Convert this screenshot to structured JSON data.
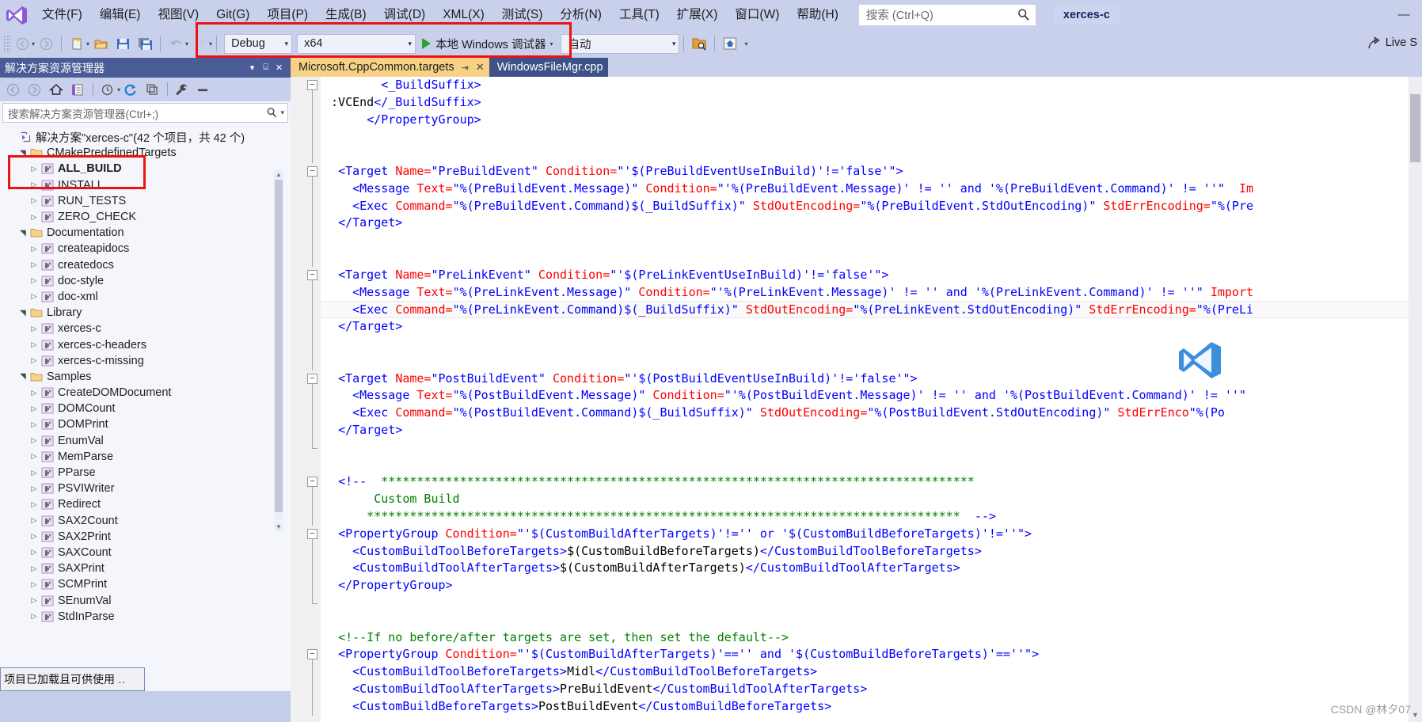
{
  "window": {
    "project_chip": "xerces-c",
    "minimize_label": "—",
    "search": {
      "placeholder": "搜索 (Ctrl+Q)",
      "icon": "magnifier-icon"
    }
  },
  "menu": {
    "items": [
      {
        "label": "文件(F)"
      },
      {
        "label": "编辑(E)"
      },
      {
        "label": "视图(V)"
      },
      {
        "label": "Git(G)"
      },
      {
        "label": "项目(P)"
      },
      {
        "label": "生成(B)"
      },
      {
        "label": "调试(D)"
      },
      {
        "label": "XML(X)"
      },
      {
        "label": "测试(S)"
      },
      {
        "label": "分析(N)"
      },
      {
        "label": "工具(T)"
      },
      {
        "label": "扩展(X)"
      },
      {
        "label": "窗口(W)"
      },
      {
        "label": "帮助(H)"
      }
    ]
  },
  "toolbar": {
    "configuration": "Debug",
    "platform": "x64",
    "start_label": "本地 Windows 调试器",
    "auto_label": "自动",
    "live_share_label": "Live S",
    "icons": [
      "back-arrow-icon",
      "forward-arrow-icon",
      "new-item-icon",
      "open-file-icon",
      "save-icon",
      "save-all-icon",
      "undo-icon",
      "redo-icon",
      "preview-changes-icon",
      "home-icon"
    ]
  },
  "solution_explorer": {
    "title": "解决方案资源管理器",
    "search_placeholder": "搜索解决方案资源管理器(Ctrl+;)",
    "toolbar_icons": [
      "back-icon",
      "forward-icon",
      "home-icon",
      "show-all-files-icon",
      "pending-changes-icon",
      "refresh-icon",
      "collapse-all-icon",
      "properties-icon",
      "preview-icon"
    ],
    "root": "解决方案\"xerces-c\"(42 个项目，共 42 个)",
    "tree": [
      {
        "label": "CMakePredefinedTargets",
        "kind": "folder",
        "depth": 1,
        "state": "expanded",
        "bold": false
      },
      {
        "label": "ALL_BUILD",
        "kind": "project",
        "depth": 2,
        "state": "collapsed",
        "bold": true
      },
      {
        "label": "INSTALL",
        "kind": "project",
        "depth": 2,
        "state": "collapsed",
        "bold": false
      },
      {
        "label": "RUN_TESTS",
        "kind": "project",
        "depth": 2,
        "state": "collapsed",
        "bold": false
      },
      {
        "label": "ZERO_CHECK",
        "kind": "project",
        "depth": 2,
        "state": "collapsed",
        "bold": false
      },
      {
        "label": "Documentation",
        "kind": "folder",
        "depth": 1,
        "state": "expanded",
        "bold": false
      },
      {
        "label": "createapidocs",
        "kind": "project",
        "depth": 2,
        "state": "collapsed",
        "bold": false
      },
      {
        "label": "createdocs",
        "kind": "project",
        "depth": 2,
        "state": "collapsed",
        "bold": false
      },
      {
        "label": "doc-style",
        "kind": "project",
        "depth": 2,
        "state": "collapsed",
        "bold": false
      },
      {
        "label": "doc-xml",
        "kind": "project",
        "depth": 2,
        "state": "collapsed",
        "bold": false
      },
      {
        "label": "Library",
        "kind": "folder",
        "depth": 1,
        "state": "expanded",
        "bold": false
      },
      {
        "label": "xerces-c",
        "kind": "project",
        "depth": 2,
        "state": "collapsed",
        "bold": false
      },
      {
        "label": "xerces-c-headers",
        "kind": "project",
        "depth": 2,
        "state": "collapsed",
        "bold": false
      },
      {
        "label": "xerces-c-missing",
        "kind": "project",
        "depth": 2,
        "state": "collapsed",
        "bold": false
      },
      {
        "label": "Samples",
        "kind": "folder",
        "depth": 1,
        "state": "expanded",
        "bold": false
      },
      {
        "label": "CreateDOMDocument",
        "kind": "project",
        "depth": 2,
        "state": "collapsed",
        "bold": false
      },
      {
        "label": "DOMCount",
        "kind": "project",
        "depth": 2,
        "state": "collapsed",
        "bold": false
      },
      {
        "label": "DOMPrint",
        "kind": "project",
        "depth": 2,
        "state": "collapsed",
        "bold": false
      },
      {
        "label": "EnumVal",
        "kind": "project",
        "depth": 2,
        "state": "collapsed",
        "bold": false
      },
      {
        "label": "MemParse",
        "kind": "project",
        "depth": 2,
        "state": "collapsed",
        "bold": false
      },
      {
        "label": "PParse",
        "kind": "project",
        "depth": 2,
        "state": "collapsed",
        "bold": false
      },
      {
        "label": "PSVIWriter",
        "kind": "project",
        "depth": 2,
        "state": "collapsed",
        "bold": false
      },
      {
        "label": "Redirect",
        "kind": "project",
        "depth": 2,
        "state": "collapsed",
        "bold": false
      },
      {
        "label": "SAX2Count",
        "kind": "project",
        "depth": 2,
        "state": "collapsed",
        "bold": false
      },
      {
        "label": "SAX2Print",
        "kind": "project",
        "depth": 2,
        "state": "collapsed",
        "bold": false
      },
      {
        "label": "SAXCount",
        "kind": "project",
        "depth": 2,
        "state": "collapsed",
        "bold": false
      },
      {
        "label": "SAXPrint",
        "kind": "project",
        "depth": 2,
        "state": "collapsed",
        "bold": false
      },
      {
        "label": "SCMPrint",
        "kind": "project",
        "depth": 2,
        "state": "collapsed",
        "bold": false
      },
      {
        "label": "SEnumVal",
        "kind": "project",
        "depth": 2,
        "state": "collapsed",
        "bold": false
      },
      {
        "label": "StdInParse",
        "kind": "project",
        "depth": 2,
        "state": "collapsed",
        "bold": false
      }
    ]
  },
  "status_bar": {
    "text": "项目已加载且可供使用"
  },
  "editor": {
    "tabs": [
      {
        "label": "Microsoft.CppCommon.targets",
        "active": true,
        "pin": "pin-icon",
        "close": "✕"
      },
      {
        "label": "WindowsFileMgr.cpp",
        "active": false
      }
    ],
    "lines": [
      {
        "fold": "minus",
        "segs": [
          {
            "t": "        ",
            "c": "tx"
          },
          {
            "t": "<_BuildSuffix>",
            "c": "tg"
          }
        ]
      },
      {
        "fold": "bar",
        "segs": [
          {
            "t": " :VCEnd",
            "c": "tx"
          },
          {
            "t": "</_BuildSuffix>",
            "c": "tg"
          }
        ]
      },
      {
        "fold": "bar",
        "segs": [
          {
            "t": "      ",
            "c": "tx"
          },
          {
            "t": "</PropertyGroup>",
            "c": "tg"
          }
        ]
      },
      {
        "fold": "bar",
        "segs": []
      },
      {
        "fold": "bar",
        "segs": []
      },
      {
        "fold": "minus",
        "segs": [
          {
            "t": "  ",
            "c": "tx"
          },
          {
            "t": "<Target ",
            "c": "tg"
          },
          {
            "t": "Name=",
            "c": "at"
          },
          {
            "t": "\"PreBuildEvent\"",
            "c": "av"
          },
          {
            "t": " Condition=",
            "c": "at"
          },
          {
            "t": "\"'$(PreBuildEventUseInBuild)'!='false'\"",
            "c": "av"
          },
          {
            "t": ">",
            "c": "tg"
          }
        ]
      },
      {
        "fold": "bar",
        "segs": [
          {
            "t": "    ",
            "c": "tx"
          },
          {
            "t": "<Message ",
            "c": "tg"
          },
          {
            "t": "Text=",
            "c": "at"
          },
          {
            "t": "\"%(PreBuildEvent.Message)\"",
            "c": "av"
          },
          {
            "t": " Condition=",
            "c": "at"
          },
          {
            "t": "\"'%(PreBuildEvent.Message)' != '' and '%(PreBuildEvent.Command)' != ''\"",
            "c": "av"
          },
          {
            "t": "  Im",
            "c": "at"
          }
        ]
      },
      {
        "fold": "bar",
        "segs": [
          {
            "t": "    ",
            "c": "tx"
          },
          {
            "t": "<Exec ",
            "c": "tg"
          },
          {
            "t": "Command=",
            "c": "at"
          },
          {
            "t": "\"%(PreBuildEvent.Command)$(_BuildSuffix)\"",
            "c": "av"
          },
          {
            "t": " StdOutEncoding=",
            "c": "at"
          },
          {
            "t": "\"%(PreBuildEvent.StdOutEncoding)\"",
            "c": "av"
          },
          {
            "t": " StdErrEncoding=",
            "c": "at"
          },
          {
            "t": "\"%(Pre",
            "c": "av"
          }
        ]
      },
      {
        "fold": "bar",
        "segs": [
          {
            "t": "  ",
            "c": "tx"
          },
          {
            "t": "</Target>",
            "c": "tg"
          }
        ]
      },
      {
        "fold": "bar",
        "segs": []
      },
      {
        "fold": "bar",
        "segs": []
      },
      {
        "fold": "minus",
        "segs": [
          {
            "t": "  ",
            "c": "tx"
          },
          {
            "t": "<Target ",
            "c": "tg"
          },
          {
            "t": "Name=",
            "c": "at"
          },
          {
            "t": "\"PreLinkEvent\"",
            "c": "av"
          },
          {
            "t": " Condition=",
            "c": "at"
          },
          {
            "t": "\"'$(PreLinkEventUseInBuild)'!='false'\"",
            "c": "av"
          },
          {
            "t": ">",
            "c": "tg"
          }
        ]
      },
      {
        "fold": "bar",
        "segs": [
          {
            "t": "    ",
            "c": "tx"
          },
          {
            "t": "<Message ",
            "c": "tg"
          },
          {
            "t": "Text=",
            "c": "at"
          },
          {
            "t": "\"%(PreLinkEvent.Message)\"",
            "c": "av"
          },
          {
            "t": " Condition=",
            "c": "at"
          },
          {
            "t": "\"'%(PreLinkEvent.Message)' != '' and '%(PreLinkEvent.Command)' != ''\"",
            "c": "av"
          },
          {
            "t": " Import",
            "c": "at"
          }
        ]
      },
      {
        "hl": true,
        "fold": "bar",
        "segs": [
          {
            "t": "    ",
            "c": "tx"
          },
          {
            "t": "<Exec ",
            "c": "tg"
          },
          {
            "t": "Command=",
            "c": "at"
          },
          {
            "t": "\"%(PreLinkEvent.Command)$(_BuildSuffix)\"",
            "c": "av"
          },
          {
            "t": " StdOutEncoding=",
            "c": "at"
          },
          {
            "t": "\"%(PreLinkEvent.StdOutEncoding)\"",
            "c": "av"
          },
          {
            "t": " StdErrEncoding=",
            "c": "at"
          },
          {
            "t": "\"%(PreLi",
            "c": "av"
          }
        ]
      },
      {
        "fold": "bar",
        "segs": [
          {
            "t": "  ",
            "c": "tx"
          },
          {
            "t": "</Target>",
            "c": "tg"
          }
        ]
      },
      {
        "fold": "bar",
        "segs": []
      },
      {
        "fold": "bar",
        "segs": []
      },
      {
        "fold": "minus",
        "segs": [
          {
            "t": "  ",
            "c": "tx"
          },
          {
            "t": "<Target ",
            "c": "tg"
          },
          {
            "t": "Name=",
            "c": "at"
          },
          {
            "t": "\"PostBuildEvent\"",
            "c": "av"
          },
          {
            "t": " Condition=",
            "c": "at"
          },
          {
            "t": "\"'$(PostBuildEventUseInBuild)'!='false'\"",
            "c": "av"
          },
          {
            "t": ">",
            "c": "tg"
          }
        ]
      },
      {
        "fold": "bar",
        "segs": [
          {
            "t": "    ",
            "c": "tx"
          },
          {
            "t": "<Message ",
            "c": "tg"
          },
          {
            "t": "Text=",
            "c": "at"
          },
          {
            "t": "\"%(PostBuildEvent.Message)\"",
            "c": "av"
          },
          {
            "t": " Condition=",
            "c": "at"
          },
          {
            "t": "\"'%(PostBuildEvent.Message)' != '' and '%(PostBuildEvent.Command)' != ''\"",
            "c": "av"
          },
          {
            "t": " ",
            "c": "at"
          }
        ]
      },
      {
        "fold": "bar",
        "segs": [
          {
            "t": "    ",
            "c": "tx"
          },
          {
            "t": "<Exec ",
            "c": "tg"
          },
          {
            "t": "Command=",
            "c": "at"
          },
          {
            "t": "\"%(PostBuildEvent.Command)$(_BuildSuffix)\"",
            "c": "av"
          },
          {
            "t": " StdOutEncoding=",
            "c": "at"
          },
          {
            "t": "\"%(PostBuildEvent.StdOutEncoding)\"",
            "c": "av"
          },
          {
            "t": " StdErrEnco",
            "c": "at"
          },
          {
            "t": "\"%(Po",
            "c": "av"
          }
        ]
      },
      {
        "fold": "bar",
        "segs": [
          {
            "t": "  ",
            "c": "tx"
          },
          {
            "t": "</Target>",
            "c": "tg"
          }
        ]
      },
      {
        "fold": "end",
        "segs": []
      },
      {
        "fold": "none",
        "segs": []
      },
      {
        "fold": "minus",
        "segs": [
          {
            "t": "  ",
            "c": "tx"
          },
          {
            "t": "<!--",
            "c": "tg"
          },
          {
            "t": "  ***********************************************************************************",
            "c": "cm"
          }
        ]
      },
      {
        "fold": "bar",
        "segs": [
          {
            "t": "       Custom Build",
            "c": "cm"
          }
        ]
      },
      {
        "fold": "bar",
        "segs": [
          {
            "t": "      ***********************************************************************************  ",
            "c": "cm"
          },
          {
            "t": "-->",
            "c": "tg"
          }
        ]
      },
      {
        "fold": "minus",
        "segs": [
          {
            "t": "  ",
            "c": "tx"
          },
          {
            "t": "<PropertyGroup ",
            "c": "tg"
          },
          {
            "t": "Condition=",
            "c": "at"
          },
          {
            "t": "\"'$(CustomBuildAfterTargets)'!='' or '$(CustomBuildBeforeTargets)'!=''\"",
            "c": "av"
          },
          {
            "t": ">",
            "c": "tg"
          }
        ]
      },
      {
        "fold": "bar",
        "segs": [
          {
            "t": "    ",
            "c": "tx"
          },
          {
            "t": "<CustomBuildToolBeforeTargets>",
            "c": "tg"
          },
          {
            "t": "$(CustomBuildBeforeTargets)",
            "c": "tx"
          },
          {
            "t": "</CustomBuildToolBeforeTargets>",
            "c": "tg"
          }
        ]
      },
      {
        "fold": "bar",
        "segs": [
          {
            "t": "    ",
            "c": "tx"
          },
          {
            "t": "<CustomBuildToolAfterTargets>",
            "c": "tg"
          },
          {
            "t": "$(CustomBuildAfterTargets)",
            "c": "tx"
          },
          {
            "t": "</CustomBuildToolAfterTargets>",
            "c": "tg"
          }
        ]
      },
      {
        "fold": "bar",
        "segs": [
          {
            "t": "  ",
            "c": "tx"
          },
          {
            "t": "</PropertyGroup>",
            "c": "tg"
          }
        ]
      },
      {
        "fold": "end",
        "segs": []
      },
      {
        "fold": "none",
        "segs": []
      },
      {
        "fold": "none",
        "segs": [
          {
            "t": "  ",
            "c": "tx"
          },
          {
            "t": "<!--If no before/after targets are set, then set the default-->",
            "c": "cm"
          }
        ]
      },
      {
        "fold": "minus",
        "segs": [
          {
            "t": "  ",
            "c": "tx"
          },
          {
            "t": "<PropertyGroup ",
            "c": "tg"
          },
          {
            "t": "Condition=",
            "c": "at"
          },
          {
            "t": "\"'$(CustomBuildAfterTargets)'=='' and '$(CustomBuildBeforeTargets)'==''\"",
            "c": "av"
          },
          {
            "t": ">",
            "c": "tg"
          }
        ]
      },
      {
        "fold": "bar",
        "segs": [
          {
            "t": "    ",
            "c": "tx"
          },
          {
            "t": "<CustomBuildToolBeforeTargets>",
            "c": "tg"
          },
          {
            "t": "Midl",
            "c": "tx"
          },
          {
            "t": "</CustomBuildToolBeforeTargets>",
            "c": "tg"
          }
        ]
      },
      {
        "fold": "bar",
        "segs": [
          {
            "t": "    ",
            "c": "tx"
          },
          {
            "t": "<CustomBuildToolAfterTargets>",
            "c": "tg"
          },
          {
            "t": "PreBuildEvent",
            "c": "tx"
          },
          {
            "t": "</CustomBuildToolAfterTargets>",
            "c": "tg"
          }
        ]
      },
      {
        "fold": "bar",
        "segs": [
          {
            "t": "    ",
            "c": "tx"
          },
          {
            "t": "<CustomBuildBeforeTargets>",
            "c": "tg"
          },
          {
            "t": "PostBuildEvent",
            "c": "tx"
          },
          {
            "t": "</CustomBuildBeforeTargets>",
            "c": "tg"
          }
        ]
      }
    ]
  },
  "watermark": {
    "text": "CSDN @林夕07"
  },
  "colors": {
    "chrome": "#c8d0ec",
    "panel_header": "#4a5c96",
    "active_tab": "#f7d186",
    "inactive_tab": "#3c5288",
    "annotation": "#ee1111",
    "tag": "#0000ff",
    "attribute": "#ff0000",
    "comment": "#008000"
  }
}
